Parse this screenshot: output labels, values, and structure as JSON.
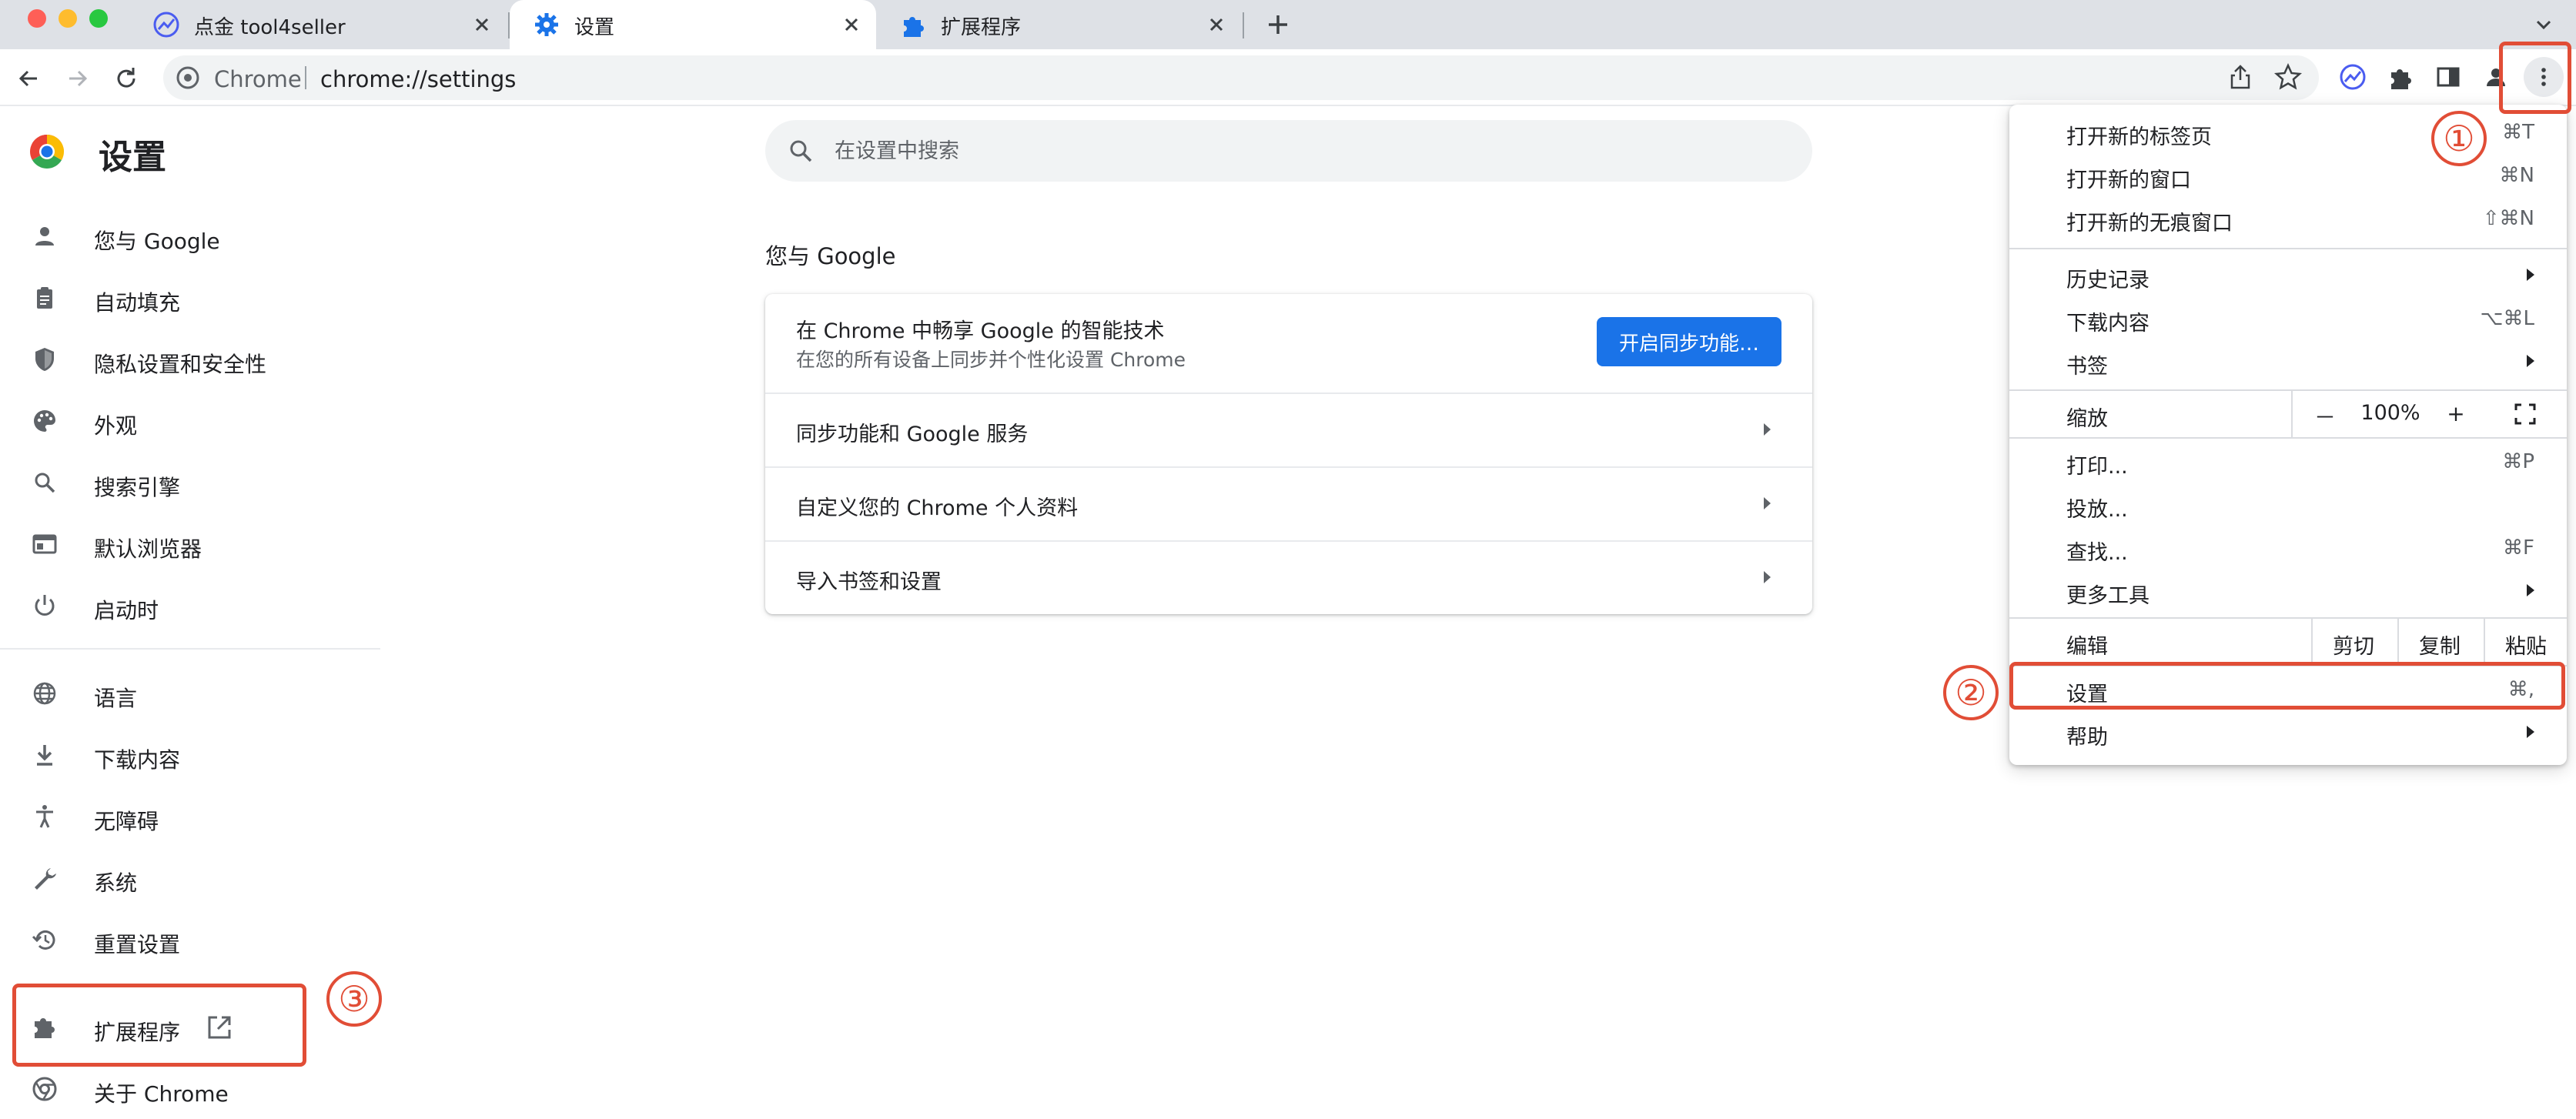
{
  "tabs": [
    {
      "title": "点金 tool4seller",
      "icon": "tool4seller-trend-icon"
    },
    {
      "title": "设置",
      "icon": "gear-icon",
      "active": true
    },
    {
      "title": "扩展程序",
      "icon": "puzzle-piece-icon"
    }
  ],
  "toolbar": {
    "site_name": "Chrome",
    "url": "chrome://settings"
  },
  "settings": {
    "title": "设置",
    "search_placeholder": "在设置中搜索"
  },
  "nav": [
    {
      "label": "您与 Google",
      "icon": "person-icon"
    },
    {
      "label": "自动填充",
      "icon": "clipboard-icon"
    },
    {
      "label": "隐私设置和安全性",
      "icon": "shield-icon"
    },
    {
      "label": "外观",
      "icon": "palette-icon"
    },
    {
      "label": "搜索引擎",
      "icon": "search-icon"
    },
    {
      "label": "默认浏览器",
      "icon": "browser-window-icon"
    },
    {
      "label": "启动时",
      "icon": "power-icon"
    },
    {
      "label": "语言",
      "icon": "globe-icon"
    },
    {
      "label": "下载内容",
      "icon": "download-icon"
    },
    {
      "label": "无障碍",
      "icon": "accessibility-icon"
    },
    {
      "label": "系统",
      "icon": "wrench-icon"
    },
    {
      "label": "重置设置",
      "icon": "reset-history-icon"
    },
    {
      "label": "扩展程序",
      "icon": "puzzle-piece-icon"
    },
    {
      "label": "关于 Chrome",
      "icon": "chrome-logo-icon"
    }
  ],
  "main": {
    "section_title": "您与 Google",
    "promo_title": "在 Chrome 中畅享 Google 的智能技术",
    "promo_subtitle": "在您的所有设备上同步并个性化设置 Chrome",
    "sync_button": "开启同步功能…",
    "rows": [
      "同步功能和 Google 服务",
      "自定义您的 Chrome 个人资料",
      "导入书签和设置"
    ]
  },
  "menu": {
    "new_tab": {
      "label": "打开新的标签页",
      "shortcut": "⌘T"
    },
    "new_window": {
      "label": "打开新的窗口",
      "shortcut": "⌘N"
    },
    "new_incognito": {
      "label": "打开新的无痕窗口",
      "shortcut": "⇧⌘N"
    },
    "history": {
      "label": "历史记录"
    },
    "downloads": {
      "label": "下载内容",
      "shortcut": "⌥⌘L"
    },
    "bookmarks": {
      "label": "书签"
    },
    "zoom": {
      "label": "缩放",
      "minus": "－",
      "value": "100%",
      "plus": "+"
    },
    "print": {
      "label": "打印...",
      "shortcut": "⌘P"
    },
    "cast": {
      "label": "投放..."
    },
    "find": {
      "label": "查找...",
      "shortcut": "⌘F"
    },
    "more_tools": {
      "label": "更多工具"
    },
    "edit": {
      "label": "编辑",
      "cut": "剪切",
      "copy": "复制",
      "paste": "粘贴"
    },
    "settings": {
      "label": "设置",
      "shortcut": "⌘,"
    },
    "help": {
      "label": "帮助"
    }
  },
  "annotations": [
    "①",
    "②",
    "③"
  ],
  "colors": {
    "accent": "#1a73e8",
    "annotation": "#e14d36",
    "tabstrip": "#dee1e6"
  }
}
